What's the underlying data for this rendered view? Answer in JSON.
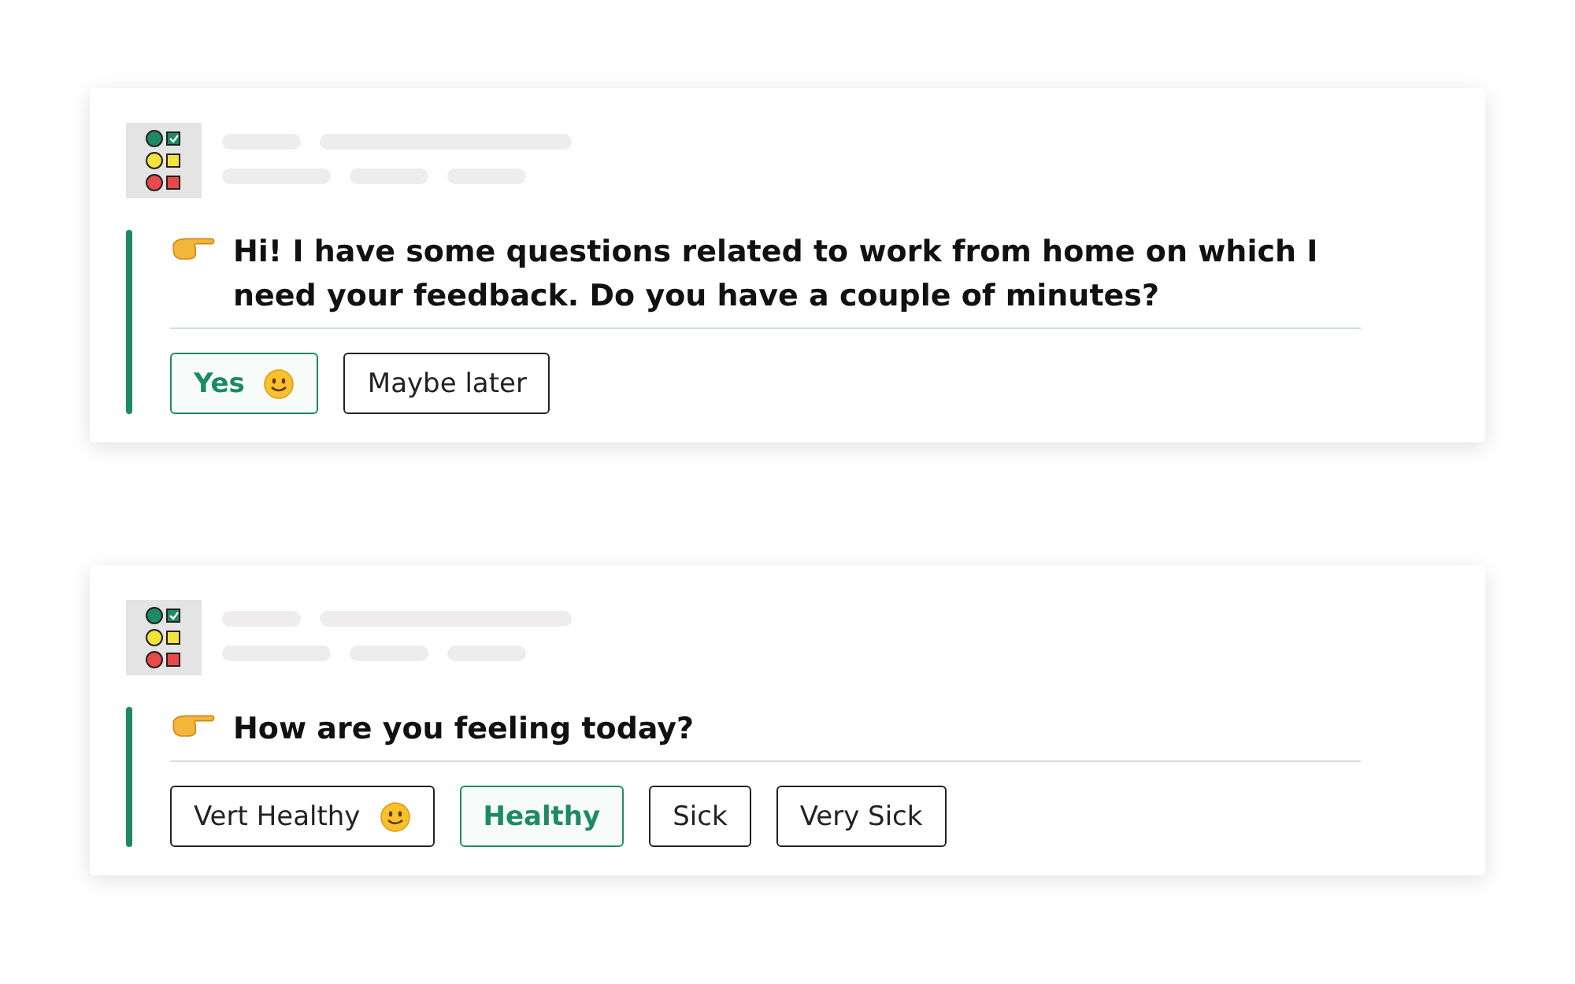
{
  "cards": [
    {
      "question": "Hi! I have some questions related to work from home on which I need your feedback. Do you have a couple of minutes?",
      "options": [
        {
          "label": "Yes",
          "smiley": true,
          "selected": true
        },
        {
          "label": "Maybe later",
          "smiley": false,
          "selected": false
        }
      ]
    },
    {
      "question": "How are you feeling today?",
      "options": [
        {
          "label": "Vert Healthy",
          "smiley": true,
          "selected": false
        },
        {
          "label": "Healthy",
          "smiley": false,
          "selected": true
        },
        {
          "label": "Sick",
          "smiley": false,
          "selected": false
        },
        {
          "label": "Very Sick",
          "smiley": false,
          "selected": false
        }
      ]
    }
  ]
}
